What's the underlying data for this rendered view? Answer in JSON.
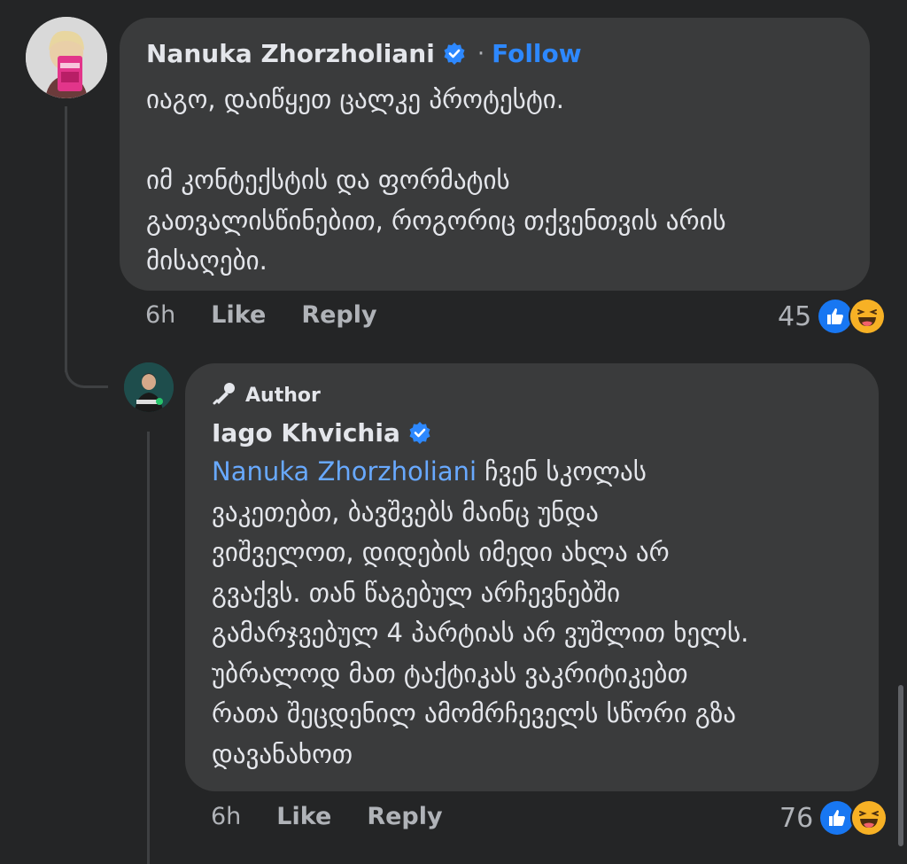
{
  "comments": [
    {
      "author": "Nanuka Zhorzholiani",
      "verified": true,
      "follow_label": "Follow",
      "separator": "·",
      "lines": [
        "იაგო, დაიწყეთ  ცალკე პროტესტი.",
        "",
        "იმ კონტექსტის და ფორმატის",
        "გათვალისწინებით, როგორიც თქვენთვის არის",
        "მისაღები."
      ],
      "time": "6h",
      "like_label": "Like",
      "reply_label": "Reply",
      "reaction_count": "45",
      "reactions": [
        "like-icon",
        "haha-icon"
      ]
    },
    {
      "badge_label": "Author",
      "author": "Iago Khvichia",
      "verified": true,
      "mention": "Nanuka Zhorzholiani",
      "first_line_rest": " ჩვენ სკოლას",
      "lines": [
        "ვაკეთებთ, ბავშვებს მაინც უნდა",
        "ვიშველოთ, დიდების იმედი ახლა არ",
        "გვაქვს. თან წაგებულ არჩევნებში",
        "გამარჯვებულ 4 პარტიას არ ვუშლით ხელს.",
        "უბრალოდ მათ ტაქტიკას ვაკრიტიკებთ",
        "რათა შეცდენილ ამომრჩეველს სწორი გზა",
        "დავანახოთ"
      ],
      "time": "6h",
      "like_label": "Like",
      "reply_label": "Reply",
      "reaction_count": "76",
      "reactions": [
        "like-icon",
        "haha-icon"
      ]
    }
  ],
  "colors": {
    "background": "#242526",
    "bubble": "#3a3b3c",
    "link": "#2d88ff",
    "mention": "#68a9ff",
    "muted": "#b0b3b8"
  }
}
